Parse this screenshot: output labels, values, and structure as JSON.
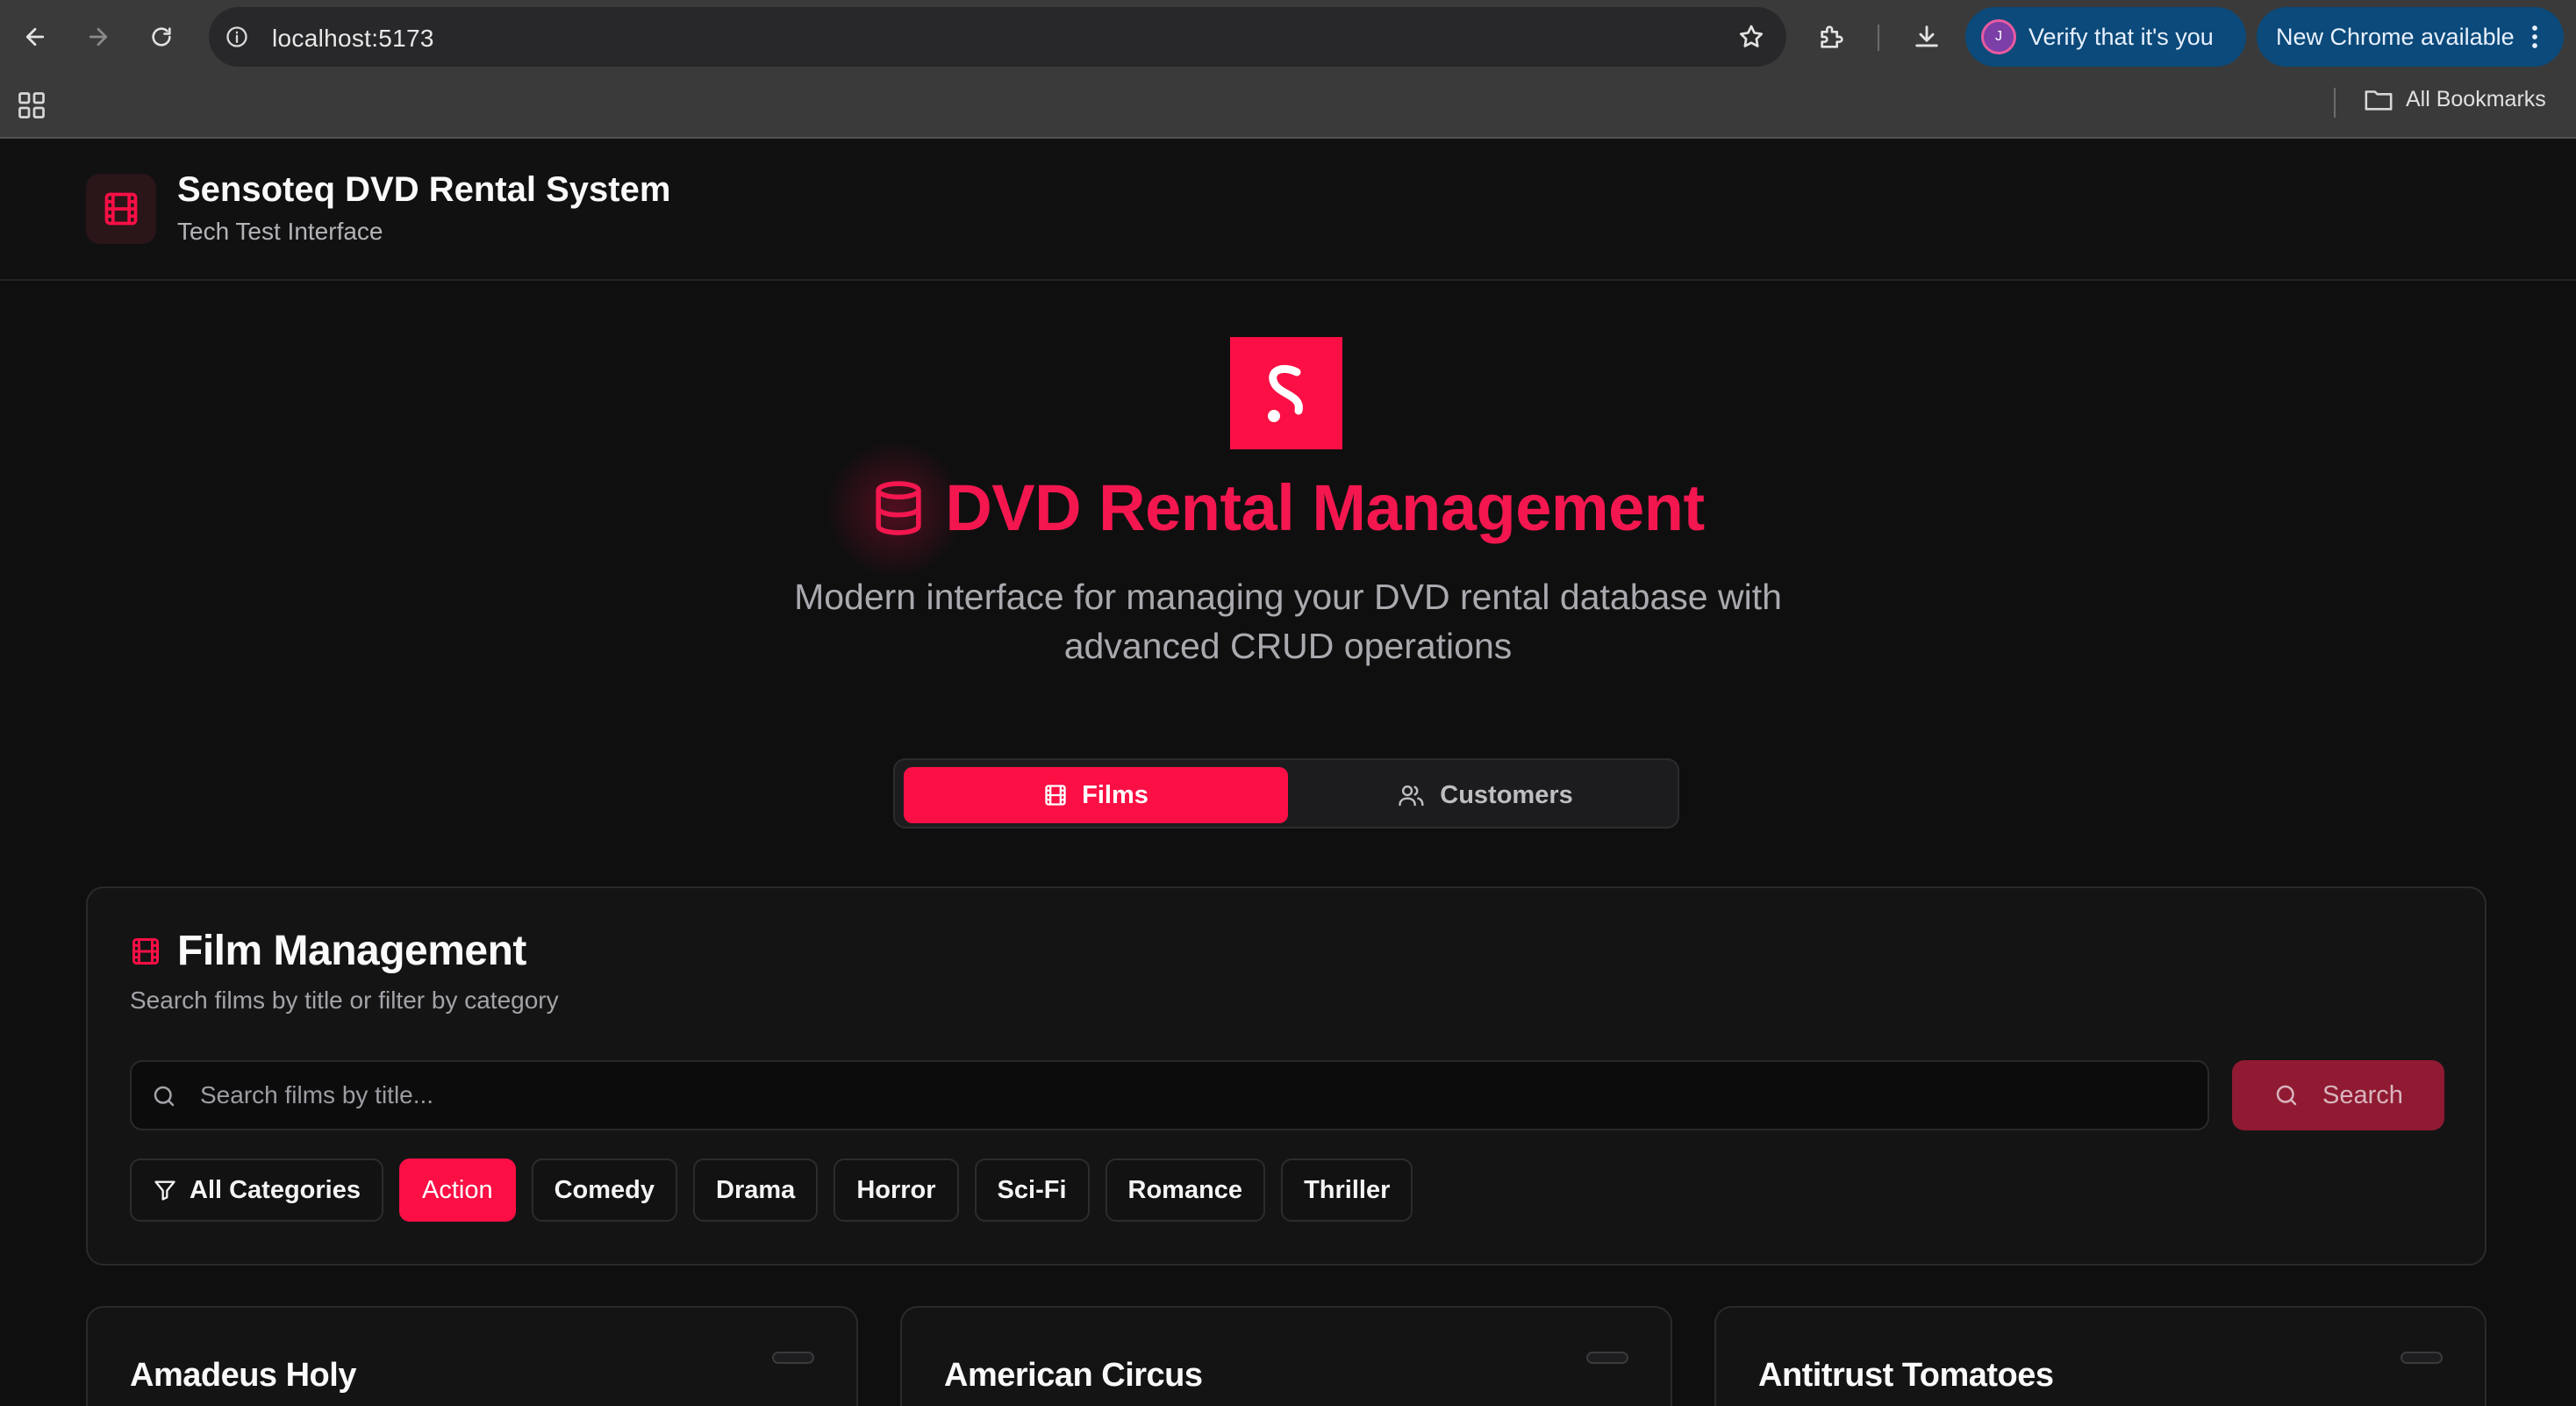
{
  "browser": {
    "url": "localhost:5173",
    "verify_label": "Verify that it's you",
    "avatar_initial": "J",
    "update_label": "New Chrome available",
    "bookmarks_label": "All Bookmarks"
  },
  "header": {
    "title": "Sensoteq DVD Rental System",
    "subtitle": "Tech Test Interface"
  },
  "hero": {
    "title": "DVD Rental Management",
    "description": "Modern interface for managing your DVD rental database with advanced CRUD operations"
  },
  "tabs": [
    {
      "label": "Films",
      "active": true
    },
    {
      "label": "Customers",
      "active": false
    }
  ],
  "film_management": {
    "title": "Film Management",
    "subtitle": "Search films by title or filter by category",
    "search_placeholder": "Search films by title...",
    "search_button": "Search",
    "categories": [
      {
        "label": "All Categories",
        "active": false
      },
      {
        "label": "Action",
        "active": true
      },
      {
        "label": "Comedy",
        "active": false
      },
      {
        "label": "Drama",
        "active": false
      },
      {
        "label": "Horror",
        "active": false
      },
      {
        "label": "Sci-Fi",
        "active": false
      },
      {
        "label": "Romance",
        "active": false
      },
      {
        "label": "Thriller",
        "active": false
      }
    ]
  },
  "films": [
    {
      "title": "Amadeus Holy"
    },
    {
      "title": "American Circus"
    },
    {
      "title": "Antitrust Tomatoes"
    }
  ],
  "colors": {
    "accent": "#fb0f45",
    "background": "#0f0f10",
    "card": "#141415"
  }
}
